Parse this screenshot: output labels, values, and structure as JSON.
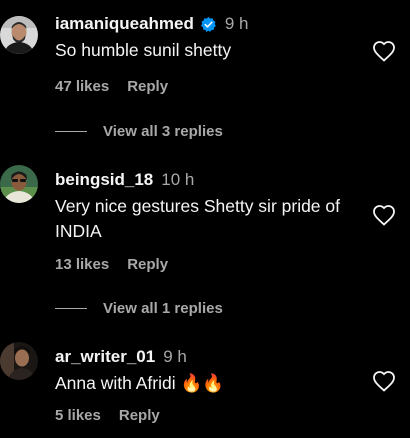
{
  "comments": [
    {
      "username": "iamaniqueahmed",
      "verified": true,
      "time": "9 h",
      "text": "So humble sunil shetty",
      "likes": "47 likes",
      "reply": "Reply",
      "view_replies": "View all 3 replies"
    },
    {
      "username": "beingsid_18",
      "verified": false,
      "time": "10 h",
      "text": "Very nice gestures Shetty sir pride of INDIA",
      "likes": "13 likes",
      "reply": "Reply",
      "view_replies": "View all 1 replies"
    },
    {
      "username": "ar_writer_01",
      "verified": false,
      "time": "9 h",
      "text": "Anna with Afridi 🔥🔥",
      "likes": "5 likes",
      "reply": "Reply"
    }
  ],
  "colors": {
    "background": "#000000",
    "primary_text": "#f5f5f5",
    "secondary_text": "#a8a8a8",
    "verified_blue": "#0095f6"
  },
  "icons": {
    "heart": "heart-outline-icon",
    "verified": "verified-badge-icon"
  }
}
